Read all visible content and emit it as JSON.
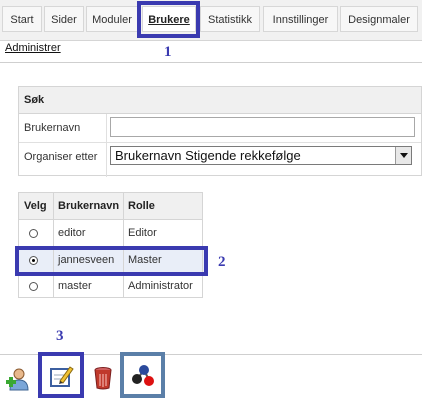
{
  "tabs": [
    {
      "label": "Start",
      "active": false
    },
    {
      "label": "Sider",
      "active": false
    },
    {
      "label": "Moduler",
      "active": false
    },
    {
      "label": "Brukere",
      "active": true
    },
    {
      "label": "Statistikk",
      "active": false
    },
    {
      "label": "Innstillinger",
      "active": false
    },
    {
      "label": "Designmaler",
      "active": false
    }
  ],
  "subnav": {
    "administer_link": "Administrer"
  },
  "search": {
    "header": "Søk",
    "username_label": "Brukernavn",
    "username_value": "",
    "sort_label": "Organiser etter",
    "sort_value": "Brukernavn Stigende rekkefølge"
  },
  "users_table": {
    "headers": [
      "Velg",
      "Brukernavn",
      "Rolle"
    ],
    "rows": [
      {
        "username": "editor",
        "role": "Editor",
        "selected": false
      },
      {
        "username": "jannesveen",
        "role": "Master",
        "selected": true
      },
      {
        "username": "master",
        "role": "Administrator",
        "selected": false
      }
    ]
  },
  "annotations": {
    "n1": "1",
    "n2": "2",
    "n3": "3"
  },
  "toolbar": {
    "icons": [
      "add-user-icon",
      "edit-icon",
      "delete-icon",
      "permissions-icon"
    ]
  },
  "colors": {
    "annotation": "#3a3ab0",
    "annotation_alt": "#5b7fa8",
    "selected_row": "#e9eef8"
  }
}
